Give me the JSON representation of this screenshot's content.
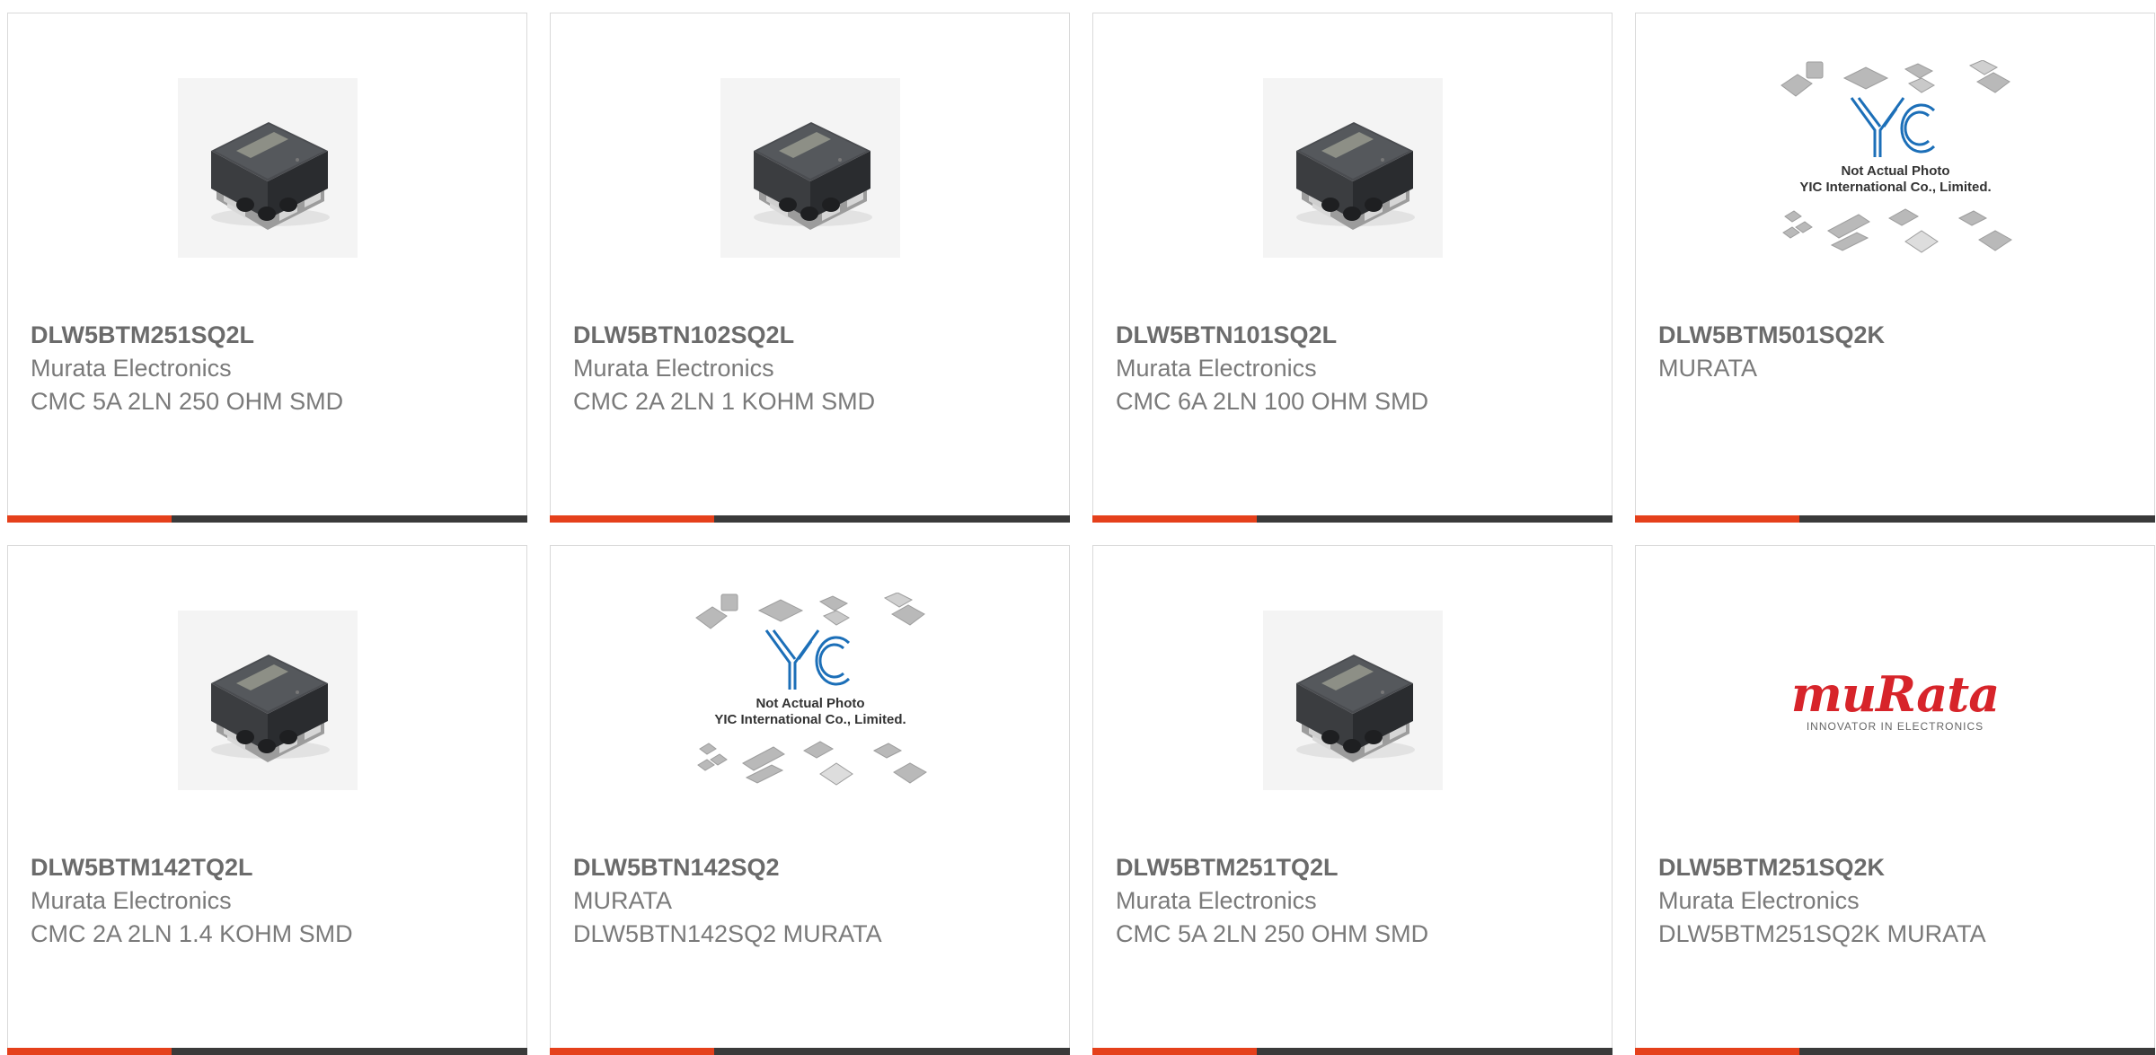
{
  "cards": [
    {
      "part": "DLW5BTM251SQ2L",
      "mfr": "Murata Electronics",
      "desc": "CMC 5A 2LN 250 OHM SMD",
      "image": "choke-photo"
    },
    {
      "part": "DLW5BTN102SQ2L",
      "mfr": "Murata Electronics",
      "desc": "CMC 2A 2LN 1 KOHM SMD",
      "image": "choke-photo"
    },
    {
      "part": "DLW5BTN101SQ2L",
      "mfr": "Murata Electronics",
      "desc": "CMC 6A 2LN 100 OHM SMD",
      "image": "choke-photo"
    },
    {
      "part": "DLW5BTM501SQ2K",
      "mfr": "MURATA",
      "desc": "",
      "image": "yic-placeholder"
    },
    {
      "part": "DLW5BTM142TQ2L",
      "mfr": "Murata Electronics",
      "desc": "CMC 2A 2LN 1.4 KOHM SMD",
      "image": "choke-photo"
    },
    {
      "part": "DLW5BTN142SQ2",
      "mfr": "MURATA",
      "desc": "DLW5BTN142SQ2 MURATA",
      "image": "yic-placeholder"
    },
    {
      "part": "DLW5BTM251TQ2L",
      "mfr": "Murata Electronics",
      "desc": "CMC 5A 2LN 250 OHM SMD",
      "image": "choke-photo"
    },
    {
      "part": "DLW5BTM251SQ2K",
      "mfr": "Murata Electronics",
      "desc": "DLW5BTM251SQ2K MURATA",
      "image": "murata-logo"
    }
  ],
  "placeholder": {
    "logo": "YIC",
    "line1": "Not Actual Photo",
    "line2": "YIC International Co., Limited."
  },
  "murata_logo": {
    "word": "muRata",
    "tagline": "INNOVATOR IN ELECTRONICS"
  },
  "colors": {
    "accent": "#e5401b",
    "bar_dark": "#3a3a3a",
    "text_bold": "#6b6b6b",
    "text": "#7a7a7a",
    "border": "#d9d9d9",
    "yic_blue": "#1c6fb8",
    "murata_red": "#d7242a"
  }
}
